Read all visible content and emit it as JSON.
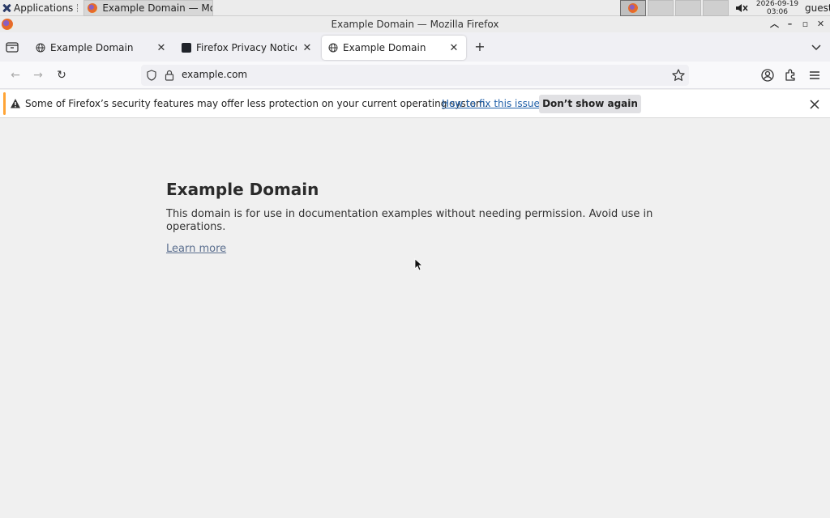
{
  "panel": {
    "applications_label": "Applications",
    "taskbar_item": "Example Domain — Mo...",
    "clock_date": "2026-09-19",
    "clock_time": "03:06",
    "user": "guest"
  },
  "window": {
    "title": "Example Domain — Mozilla Firefox"
  },
  "tabs": [
    {
      "label": "Example Domain",
      "favicon": "globe-icon",
      "selected": false
    },
    {
      "label": "Firefox Privacy Notice — ",
      "favicon": "dark-square-icon",
      "selected": false
    },
    {
      "label": "Example Domain",
      "favicon": "globe-icon",
      "selected": true
    }
  ],
  "navbar": {
    "url": "example.com"
  },
  "notification": {
    "message": "Some of Firefox’s security features may offer less protection on your current operating system.",
    "link": "How to fix this issue",
    "button": "Don’t show again",
    "accent_color": "#ffa436"
  },
  "page": {
    "title": "Example Domain",
    "description": "This domain is for use in documentation examples without needing permission. Avoid use in operations.",
    "link": "Learn more"
  }
}
